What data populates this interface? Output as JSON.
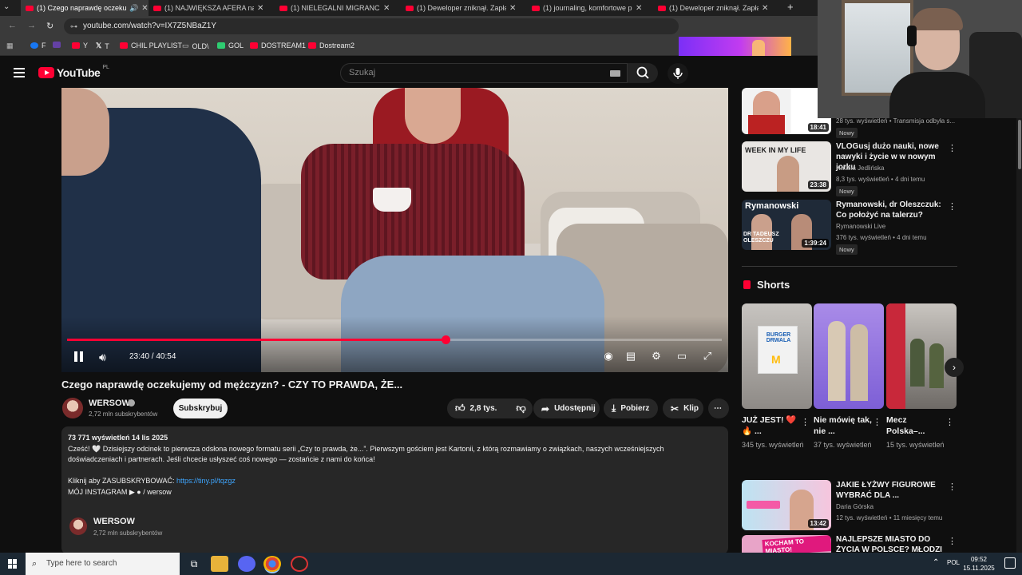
{
  "browser": {
    "tabs": [
      {
        "label": "(1) Czego naprawdę oczekuj",
        "active": true
      },
      {
        "label": "(1) NAJWIĘKSZA AFERA na UKR",
        "active": false
      },
      {
        "label": "(1) NIELEGALNI MIGRANCI WC",
        "active": false
      },
      {
        "label": "(1) Deweloper zniknął. Zapłacili",
        "active": false
      },
      {
        "label": "(1) journaling, komfortowe prze",
        "active": false
      },
      {
        "label": "(1) Deweloper zniknął. Zapłacili",
        "active": false
      }
    ],
    "new_tab": "+",
    "url": "youtube.com/watch?v=IX7Z5NBaZ1Y",
    "bookmarks": [
      {
        "label": "F",
        "color": "#1877f2"
      },
      {
        "label": "",
        "color": "#6441a5"
      },
      {
        "label": "Y",
        "color": "#ff0033"
      },
      {
        "label": "T",
        "color": "#ffffff"
      },
      {
        "label": "CHIL PLAYLIST",
        "color": "#ff0033"
      },
      {
        "label": "OLD\\",
        "color": "#cccccc"
      },
      {
        "label": "GOL",
        "color": "#2ecc71"
      },
      {
        "label": "DOSTREAM1",
        "color": "#ff0033"
      },
      {
        "label": "Dostream2",
        "color": "#ff0033"
      }
    ]
  },
  "youtube": {
    "logo_word": "YouTube",
    "logo_region": "PL",
    "search_placeholder": "Szukaj"
  },
  "player": {
    "time_current": "23:40",
    "time_total": "40:54",
    "time_label": "23:40 / 40:54",
    "progress": 0.5786
  },
  "video": {
    "title": "Czego naprawdę oczekujemy od mężczyzn? - CZY TO PRAWDA, ŻE...",
    "channel": "WERSOW",
    "subscribers": "2,72 mln subskrybentów",
    "subscribe_label": "Subskrybuj",
    "likes": "2,8 tys.",
    "share_label": "Udostępnij",
    "download_label": "Pobierz",
    "clip_label": "Klip"
  },
  "description": {
    "stats": "73 771 wyświetleń  14 lis 2025",
    "line1": "Cześć! 🤍 Dzisiejszy odcinek to pierwsza odsłona nowego formatu serii „Czy to prawda, że...”. Pierwszym gościem jest Kartonii, z którą rozmawiamy o związkach, naszych wcześniejszych",
    "line2": "doświadczeniach i partnerach. Jeśli chcecie usłyszeć coś nowego — zostańcie z nami do końca!",
    "sub_prefix": "Kliknij aby ZASUBSKRYBOWAĆ: ",
    "sub_link": "https://tiny.pl/tqzgz",
    "insta": "MÓJ INSTAGRAM ▶ ● / wersow",
    "channel": "WERSOW",
    "channel_subs": "2,72 mln subskrybentów"
  },
  "sidebar": {
    "videos": [
      {
        "title": "",
        "channel": "",
        "meta": "28 tys. wyświetleń • Transmisja odbyła s...",
        "duration": "18:41",
        "badge": "Nowy"
      },
      {
        "title": "VLOGusj dużo nauki, nowe nawyki i życie w w nowym jorku",
        "channel": "Natalia Jedlińska",
        "meta": "8,3 tys. wyświetleń • 4 dni temu",
        "duration": "23:38",
        "badge": "Nowy"
      },
      {
        "title": "Rymanowski, dr Oleszczuk: Co położyć na talerzu?",
        "channel": "Rymanowski Live",
        "meta": "376 tys. wyświetleń • 4 dni temu",
        "duration": "1:39:24",
        "badge": "Nowy"
      }
    ],
    "shorts_label": "Shorts",
    "shorts": [
      {
        "title": "JUŻ JEST! ❤️🔥 ...",
        "views": "345 tys. wyświetleń"
      },
      {
        "title": "Nie mówię tak, nie ...",
        "views": "37 tys. wyświetleń"
      },
      {
        "title": "Mecz Polska–...",
        "views": "15 tys. wyświetleń"
      }
    ],
    "more_videos": [
      {
        "title": "JAKIE ŁYŻWY FIGUROWE WYBRAĆ DLA ...",
        "channel": "Daria Górska",
        "meta": "12 tys. wyświetleń • 11 miesięcy temu",
        "duration": "13:42"
      },
      {
        "title": "NAJLEPSZE MIASTO DO ŻYCIA W POLSCE? MŁODZI TU ...",
        "channel": "",
        "meta": "",
        "duration": ""
      }
    ]
  },
  "taskbar": {
    "search_placeholder": "Type here to search",
    "language": "POL",
    "time": "09:52",
    "date": "15.11.2025"
  },
  "thumb_text": {
    "week_in_my_life": "WEEK IN MY LIFE",
    "rymanowski": "Rymanowski",
    "dr_oleszczuk": "DR TADEUSZ OLESZCZU",
    "burger_drwala": "BURGER DRWALA",
    "kocham_miasto": "KOCHAM TO MIASTO!"
  }
}
